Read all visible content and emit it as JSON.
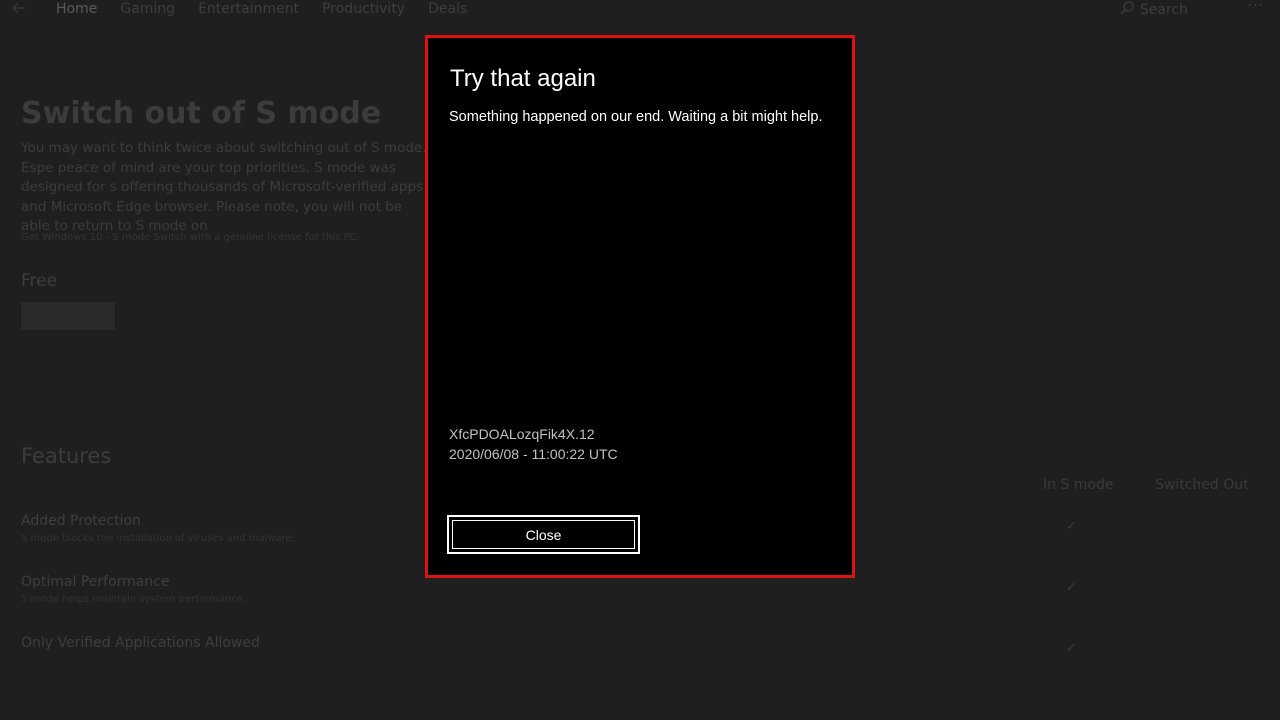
{
  "nav": {
    "back_icon": "back-arrow-icon",
    "items": [
      "Home",
      "Gaming",
      "Entertainment",
      "Productivity",
      "Deals"
    ],
    "search_label": "Search",
    "search_icon": "search-icon",
    "more_icon": "more-icon"
  },
  "product": {
    "title": "Switch out of S mode",
    "description": "You may want to think twice about switching out of S mode. Espe peace of mind are your top priorities. S mode was designed for s offering thousands of Microsoft-verified apps and Microsoft Edge browser. Please note, you will not be able to return to S mode on",
    "note": "Get Windows 10 - S mode Switch with a genuine license for this PC.",
    "price": "Free"
  },
  "features": {
    "title": "Features",
    "col_in_s_mode": "In S mode",
    "col_switched_out": "Switched Out",
    "rows": [
      {
        "title": "Added Protection",
        "desc": "S mode blocks the installation of viruses and malware."
      },
      {
        "title": "Optimal Performance",
        "desc": "S mode helps maintain system performance."
      },
      {
        "title": "Only Verified Applications Allowed",
        "desc": ""
      }
    ],
    "check_icon": "checkmark-icon"
  },
  "dialog": {
    "title": "Try that again",
    "message": "Something happened on our end. Waiting a bit might help.",
    "code": "XfcPDOALozqFik4X.12",
    "timestamp": "2020/06/08 - 11:00:22 UTC",
    "close_label": "Close",
    "border_color": "#d81414"
  }
}
